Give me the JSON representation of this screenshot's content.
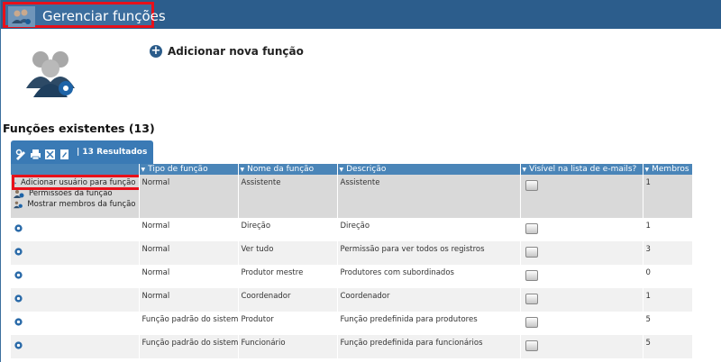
{
  "window": {
    "title": "Gerenciar funções"
  },
  "actions": {
    "add_function": "Adicionar nova função"
  },
  "section": {
    "title": "Funções existentes (13)"
  },
  "toolbar": {
    "results": "| 13 Resultados"
  },
  "table": {
    "headers": [
      "Tipo de função",
      "Nome da função",
      "Descrição",
      "Visível na lista de e-mails?",
      "Membros"
    ],
    "rows": [
      {
        "tipo": "Normal",
        "nome": "Assistente",
        "descricao": "Assistente",
        "membros": "1"
      },
      {
        "tipo": "Normal",
        "nome": "Direção",
        "descricao": "Direção",
        "membros": "1"
      },
      {
        "tipo": "Normal",
        "nome": "Ver tudo",
        "descricao": "Permissão para ver todos os registros",
        "membros": "3"
      },
      {
        "tipo": "Normal",
        "nome": "Produtor mestre",
        "descricao": "Produtores com subordinados",
        "membros": "0"
      },
      {
        "tipo": "Normal",
        "nome": "Coordenador",
        "descricao": "Coordenador",
        "membros": "1"
      },
      {
        "tipo": "Função padrão do sistema",
        "nome": "Produtor",
        "descricao": "Função predefinida para produtores",
        "membros": "5"
      },
      {
        "tipo": "Função padrão do sistema",
        "nome": "Funcionário",
        "descricao": "Função predefinida para funcionários",
        "membros": "5"
      }
    ]
  },
  "row_menu": {
    "items": [
      "Adicionar usuário para função",
      "Permissões da função",
      "Mostrar membros da função"
    ]
  },
  "colors": {
    "header_bar": "#2c5d8c",
    "table_header": "#4a85b8",
    "highlight": "#e8101a"
  }
}
